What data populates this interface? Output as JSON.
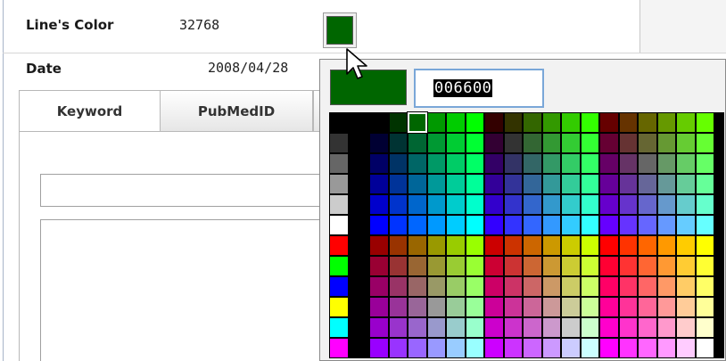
{
  "form": {
    "lines_color": {
      "label": "Line's Color",
      "value": "32768"
    },
    "date": {
      "label": "Date",
      "value": "2008/04/28"
    }
  },
  "current_color": "#006600",
  "tabs": [
    {
      "label": "Keyword",
      "active": true
    },
    {
      "label": "PubMedID",
      "active": false
    }
  ],
  "color_picker": {
    "hex_value": "006600",
    "preview_color": "#006600",
    "selected_color": "#006600",
    "left_column": [
      "#000000",
      "#333333",
      "#666666",
      "#999999",
      "#CCCCCC",
      "#FFFFFF",
      "#FF0000",
      "#00FF00",
      "#0000FF",
      "#FFFF00",
      "#00FFFF",
      "#FF00FF"
    ],
    "hex_levels": [
      "00",
      "33",
      "66",
      "99",
      "CC",
      "FF"
    ]
  }
}
